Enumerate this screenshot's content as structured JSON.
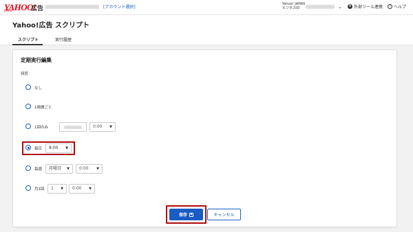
{
  "header": {
    "logo_text": "YAHOO!",
    "logo_sub": "JAPAN",
    "product_label": "広告",
    "account_select_label": "[アカウント選択]",
    "bizid_line1": "Yahoo! JAPAN",
    "bizid_line2": "ビジネスID",
    "external_tools_label": "外部ツール連携",
    "help_label": "ヘルプ"
  },
  "page": {
    "title": "Yahoo!広告 スクリプト",
    "tabs": [
      {
        "label": "スクリプト",
        "active": true
      },
      {
        "label": "実行履歴",
        "active": false
      }
    ]
  },
  "form": {
    "section_title": "定期実行編集",
    "frequency_label": "頻度",
    "options": [
      {
        "label": "なし",
        "checked": false
      },
      {
        "label": "1時間ごと",
        "checked": false
      },
      {
        "label": "1回のみ",
        "checked": false,
        "time": "0:00"
      },
      {
        "label": "毎日",
        "checked": true,
        "time": "8:00"
      },
      {
        "label": "毎週",
        "checked": false,
        "weekday": "月曜日",
        "time": "0:00"
      },
      {
        "label": "月1回",
        "checked": false,
        "day": "1",
        "time": "0:00"
      }
    ],
    "save_label": "保存",
    "cancel_label": "キャンセル"
  },
  "colors": {
    "brand_red": "#e60012",
    "accent_blue": "#1a5bc4",
    "highlight_red": "#b00a0a"
  }
}
